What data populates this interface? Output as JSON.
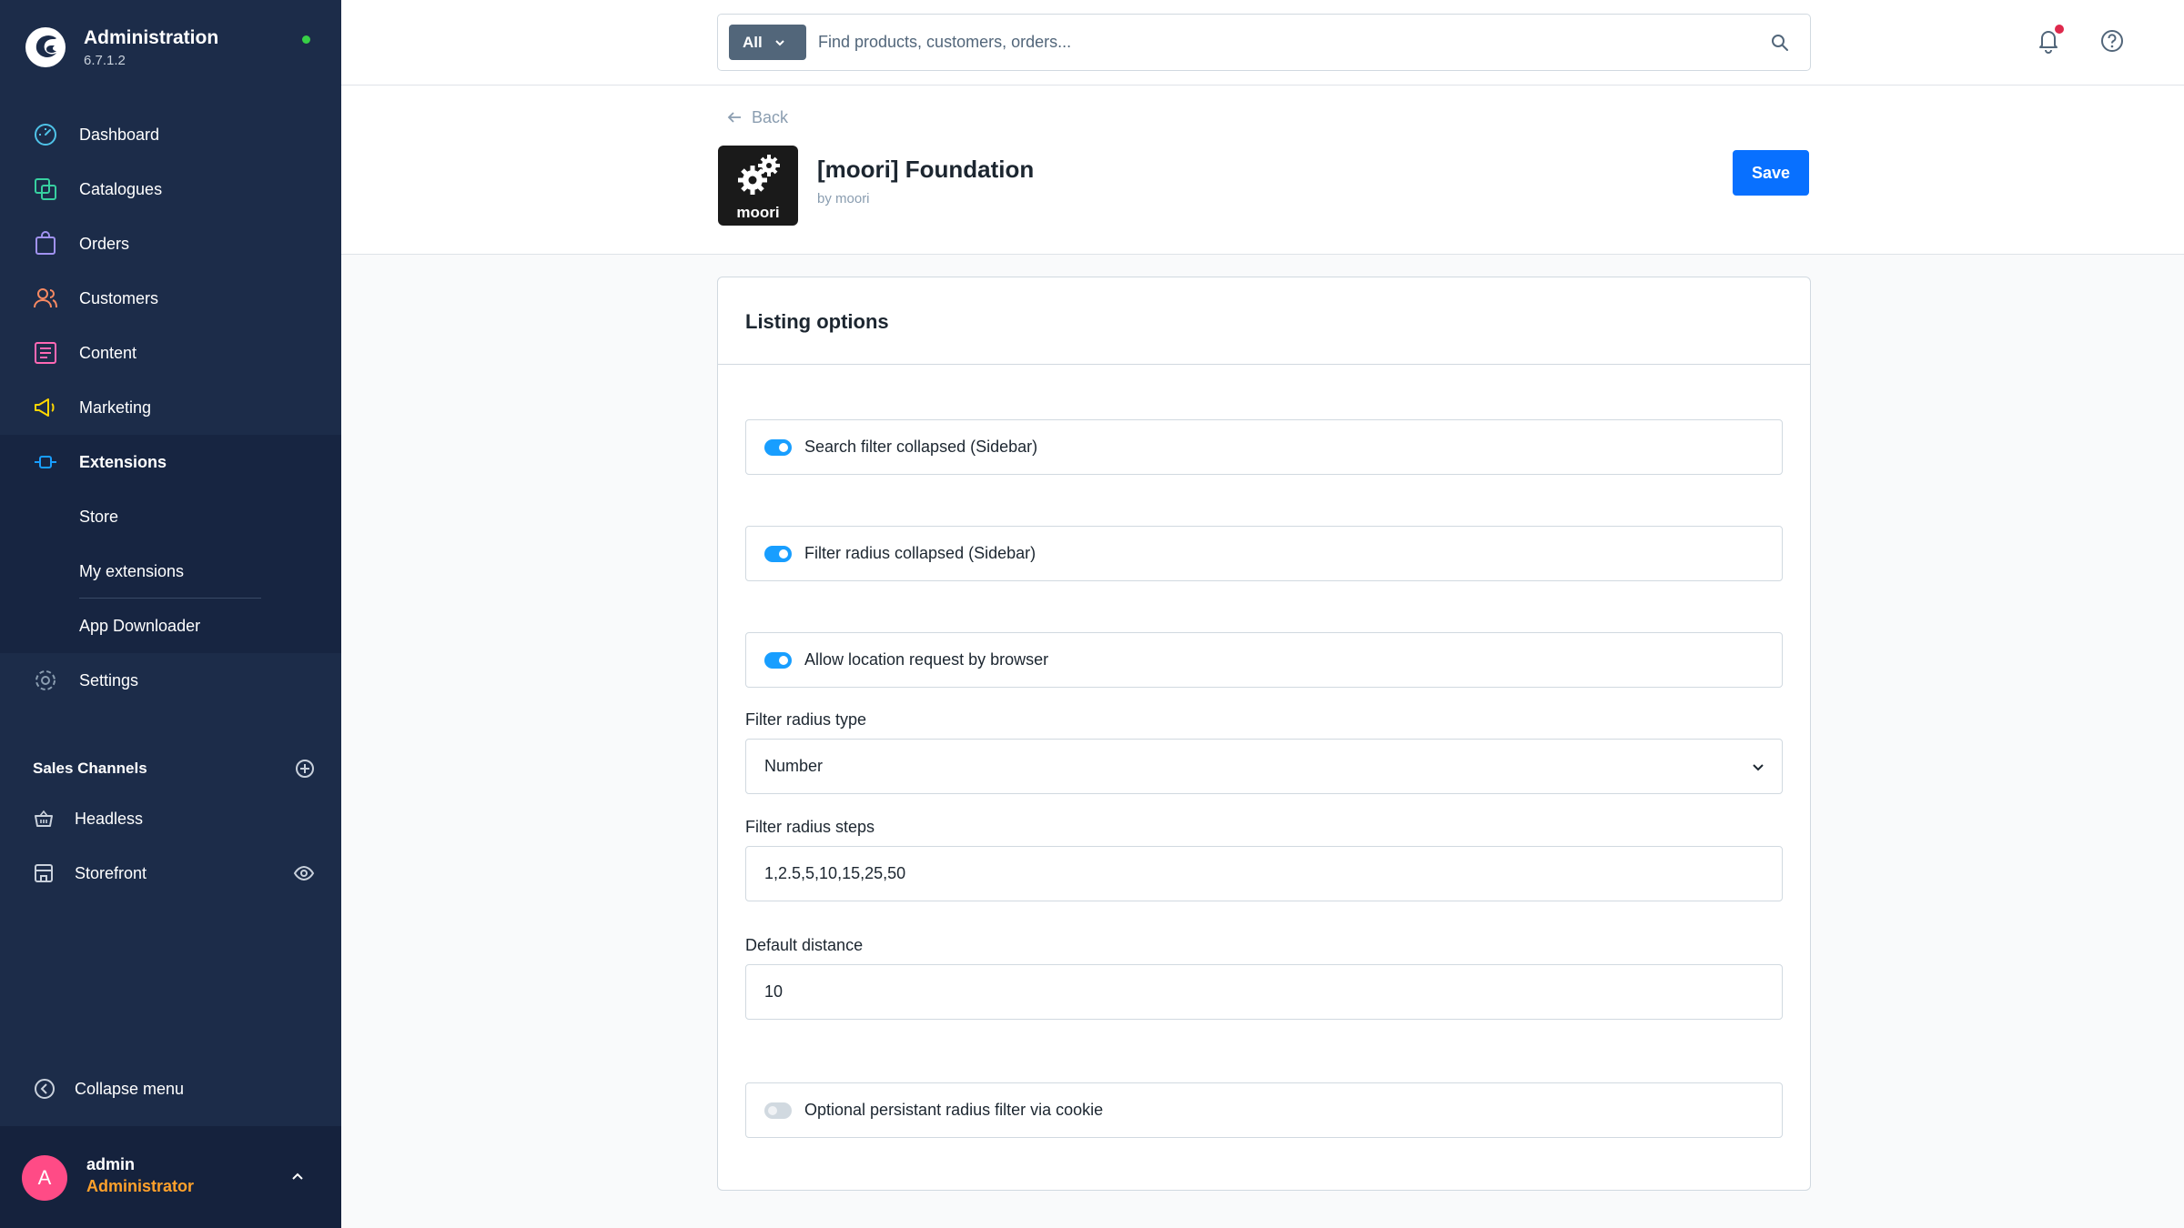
{
  "brand": {
    "title": "Administration",
    "version": "6.7.1.2"
  },
  "nav": {
    "dashboard": "Dashboard",
    "catalogues": "Catalogues",
    "orders": "Orders",
    "customers": "Customers",
    "content": "Content",
    "marketing": "Marketing",
    "extensions": "Extensions",
    "store": "Store",
    "my_extensions": "My extensions",
    "app_downloader": "App Downloader",
    "settings": "Settings"
  },
  "sales_channels": {
    "title": "Sales Channels",
    "items": [
      "Headless",
      "Storefront"
    ]
  },
  "collapse_label": "Collapse menu",
  "user": {
    "initial": "A",
    "name": "admin",
    "role": "Administrator"
  },
  "search": {
    "scope": "All",
    "placeholder": "Find products, customers, orders..."
  },
  "header": {
    "back_label": "Back",
    "logo_text": "moori",
    "plugin_title": "[moori] Foundation",
    "author": "by moori",
    "save_label": "Save"
  },
  "card": {
    "title": "Listing options",
    "switches": [
      {
        "label": "Search filter collapsed (Sidebar)",
        "checked": true
      },
      {
        "label": "Filter radius collapsed (Sidebar)",
        "checked": true
      },
      {
        "label": "Allow location request by browser",
        "checked": true
      },
      {
        "label": "Optional persistant radius filter via cookie",
        "checked": false
      }
    ],
    "radius_type": {
      "label": "Filter radius type",
      "value": "Number"
    },
    "radius_steps": {
      "label": "Filter radius steps",
      "value": "1,2.5,5,10,15,25,50"
    },
    "default_distance": {
      "label": "Default distance",
      "value": "10"
    }
  },
  "colors": {
    "sidebar_bg": "#1c2c49",
    "accent": "#0870ff",
    "toggle_on": "#189eff",
    "user_role": "#ffa12b",
    "avatar": "#ff4b86"
  }
}
